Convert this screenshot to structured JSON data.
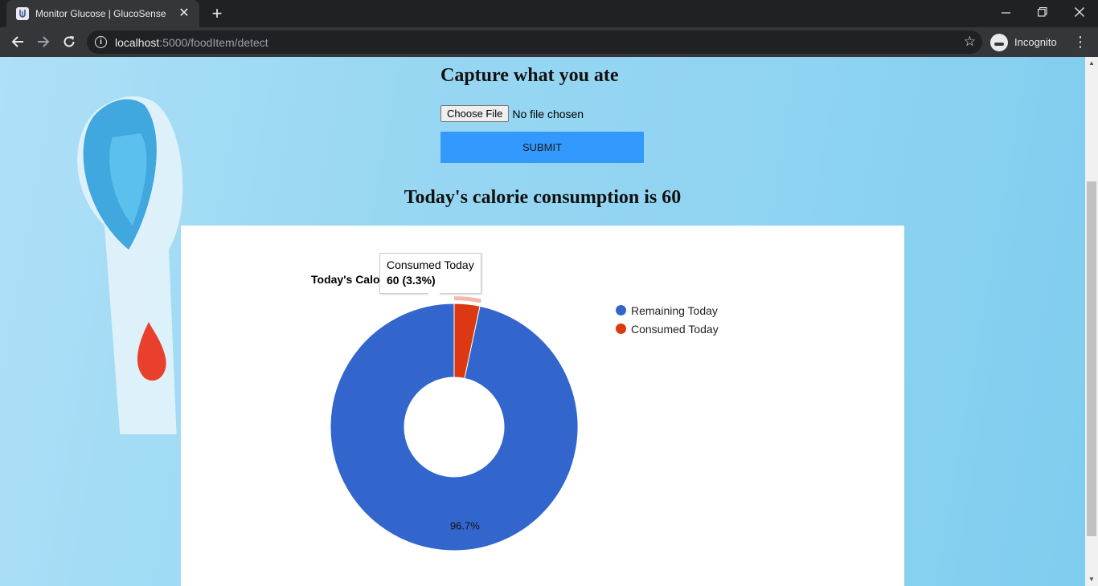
{
  "browser": {
    "tab_title": "Monitor Glucose | GlucoSense",
    "url_host": "localhost",
    "url_rest": ":5000/foodItem/detect",
    "profile_label": "Incognito"
  },
  "icons": {
    "back": "arrow-left-icon",
    "forward": "arrow-right-icon",
    "reload": "reload-icon",
    "info": "info-icon",
    "star": "star-icon",
    "incognito": "incognito-icon",
    "menu": "more-vert-icon"
  },
  "page": {
    "heading": "Capture what you ate",
    "file_button_label": "Choose File",
    "file_status": "No file chosen",
    "submit_label": "SUBMIT",
    "consumption_text": "Today's calorie consumption is 60"
  },
  "colors": {
    "remaining": "#3366cc",
    "consumed": "#dc3912",
    "submit_bg": "#3399ff"
  },
  "chart_data": {
    "type": "pie",
    "title": "Today's Calo",
    "donut": true,
    "slices": [
      {
        "label": "Remaining Today",
        "value": 1740,
        "percent_label": "96.7%"
      },
      {
        "label": "Consumed Today",
        "value": 60
      }
    ],
    "legend": [
      "Remaining Today",
      "Consumed Today"
    ],
    "legend_position": "right",
    "tooltip": {
      "label": "Consumed Today",
      "value_text": "60 (3.3%)"
    }
  }
}
